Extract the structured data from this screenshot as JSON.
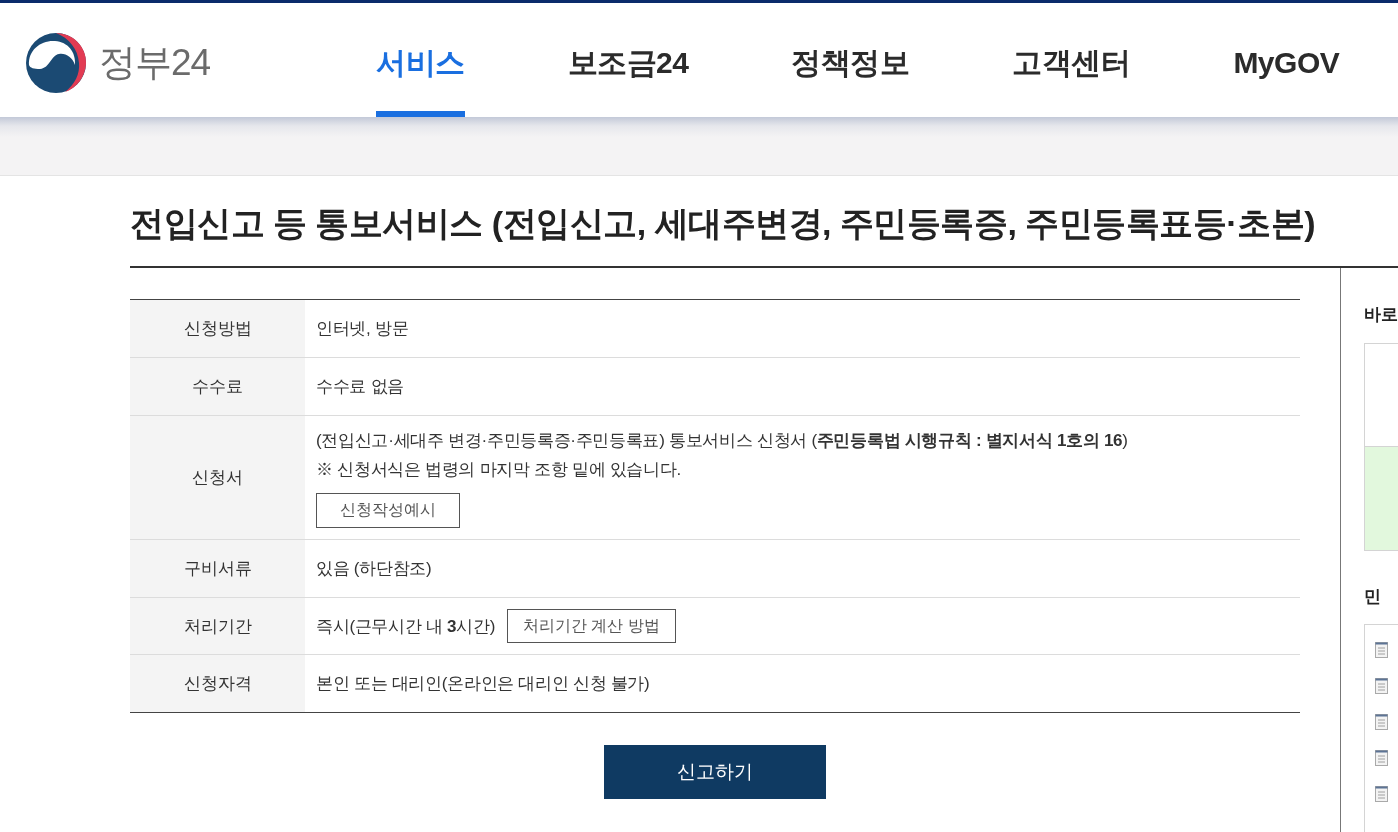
{
  "header": {
    "logo_text": "정부24",
    "nav": [
      {
        "label": "서비스",
        "selected": true
      },
      {
        "label": "보조금24",
        "selected": false
      },
      {
        "label": "정책정보",
        "selected": false
      },
      {
        "label": "고객센터",
        "selected": false
      },
      {
        "label": "MyGOV",
        "selected": false
      }
    ]
  },
  "page_title": "전입신고 등 통보서비스 (전입신고, 세대주변경, 주민등록증, 주민등록표등·초본)",
  "info_table": {
    "rows": [
      {
        "label": "신청방법",
        "kind": "text",
        "lines": [
          "인터넷, 방문"
        ]
      },
      {
        "label": "수수료",
        "kind": "text",
        "lines": [
          "수수료 없음"
        ]
      },
      {
        "label": "신청서",
        "kind": "button_below",
        "lines": [
          "(전입신고·세대주 변경·주민등록증·주민등록표) 통보서비스 신청서 (**주민등록법 시행규칙 : 별지서식 1호의 16**)",
          "※ 신청서식은 법령의 마지막 조항 밑에 있습니다."
        ],
        "button": "신청작성예시"
      },
      {
        "label": "구비서류",
        "kind": "text",
        "lines": [
          "있음 (하단참조)"
        ]
      },
      {
        "label": "처리기간",
        "kind": "button_inline",
        "lines": [
          "즉시(근무시간 내 **3**시간)"
        ],
        "button": "처리기간 계산 방법"
      },
      {
        "label": "신청자격",
        "kind": "text",
        "lines": [
          "본인 또는 대리인(온라인은 대리인 신청 불가)"
        ]
      }
    ]
  },
  "submit_button": "신고하기",
  "sidebar": {
    "sections": [
      {
        "heading": "바로",
        "kind": "quick_box"
      },
      {
        "heading": "민",
        "kind": "document_list"
      }
    ]
  }
}
